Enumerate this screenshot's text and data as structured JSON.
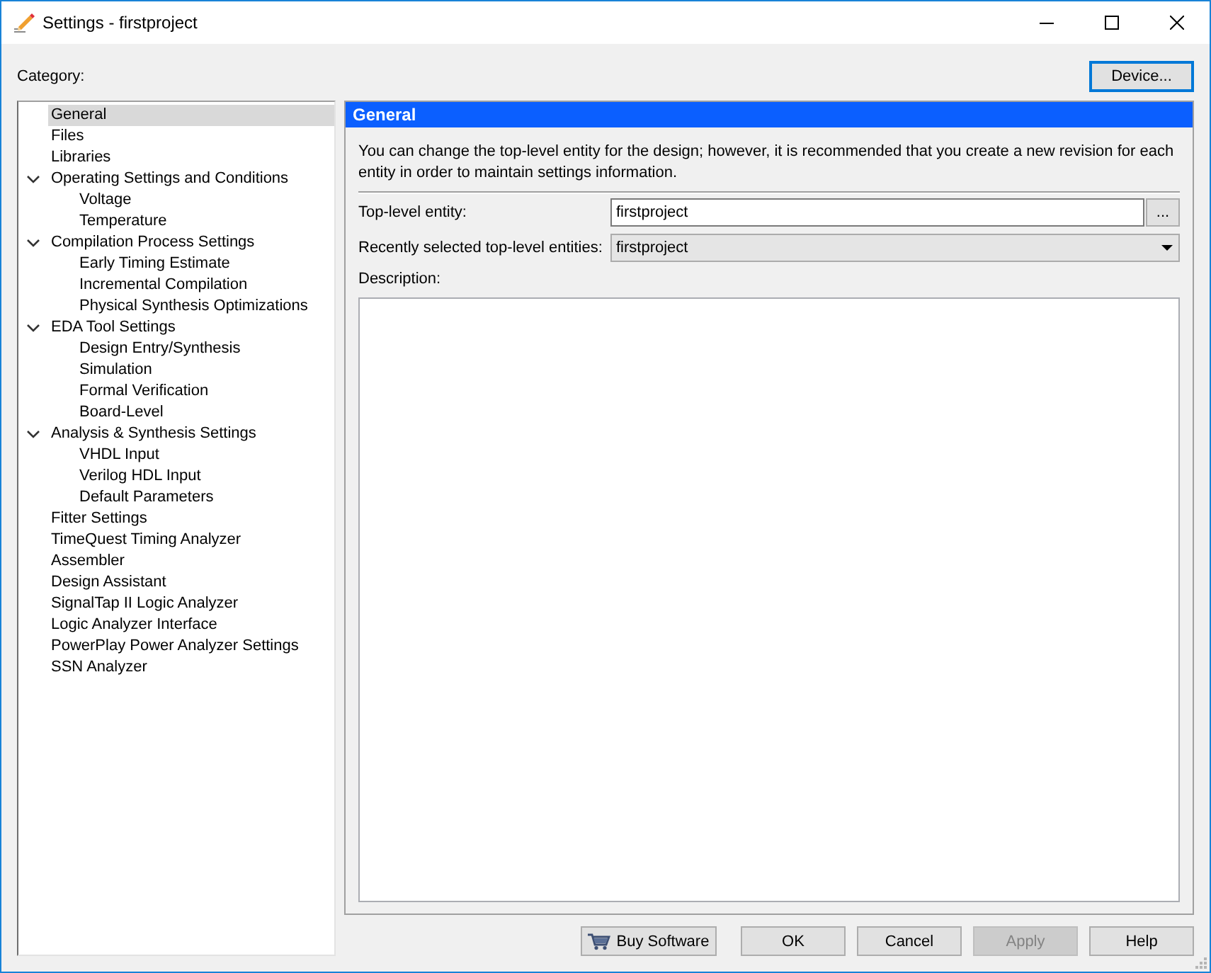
{
  "window": {
    "title": "Settings - firstproject"
  },
  "category": {
    "label": "Category:"
  },
  "device_button": {
    "label": "Device...",
    "focused": true
  },
  "tree": {
    "items": [
      {
        "label": "General",
        "selected": true
      },
      {
        "label": "Files",
        "selected": false
      },
      {
        "label": "Libraries",
        "selected": false
      },
      {
        "label": "Operating Settings and Conditions",
        "selected": false,
        "expanded": true,
        "children": [
          {
            "label": "Voltage",
            "selected": false
          },
          {
            "label": "Temperature",
            "selected": false
          }
        ]
      },
      {
        "label": "Compilation Process Settings",
        "selected": false,
        "expanded": true,
        "children": [
          {
            "label": "Early Timing Estimate",
            "selected": false
          },
          {
            "label": "Incremental Compilation",
            "selected": false
          },
          {
            "label": "Physical Synthesis Optimizations",
            "selected": false
          }
        ]
      },
      {
        "label": "EDA Tool Settings",
        "selected": false,
        "expanded": true,
        "children": [
          {
            "label": "Design Entry/Synthesis",
            "selected": false
          },
          {
            "label": "Simulation",
            "selected": false
          },
          {
            "label": "Formal Verification",
            "selected": false
          },
          {
            "label": "Board-Level",
            "selected": false
          }
        ]
      },
      {
        "label": "Analysis & Synthesis Settings",
        "selected": false,
        "expanded": true,
        "children": [
          {
            "label": "VHDL Input",
            "selected": false
          },
          {
            "label": "Verilog HDL Input",
            "selected": false
          },
          {
            "label": "Default Parameters",
            "selected": false
          }
        ]
      },
      {
        "label": "Fitter Settings",
        "selected": false
      },
      {
        "label": "TimeQuest Timing Analyzer",
        "selected": false
      },
      {
        "label": "Assembler",
        "selected": false
      },
      {
        "label": "Design Assistant",
        "selected": false
      },
      {
        "label": "SignalTap II Logic Analyzer",
        "selected": false
      },
      {
        "label": "Logic Analyzer Interface",
        "selected": false
      },
      {
        "label": "PowerPlay Power Analyzer Settings",
        "selected": false
      },
      {
        "label": "SSN Analyzer",
        "selected": false
      }
    ]
  },
  "panel": {
    "title": "General",
    "intro": "You can change the top-level entity for the design; however, it is recommended that you create a new revision for each entity in order to maintain settings information.",
    "fields": [
      {
        "kind": "text",
        "label": "Top-level entity:",
        "value": "firstproject",
        "browse_label": "..."
      },
      {
        "kind": "dropdown",
        "label": "Recently selected top-level entities:",
        "value": "firstproject"
      }
    ],
    "description": {
      "label": "Description:"
    }
  },
  "buttons": [
    {
      "kind": "purchase",
      "label": "Buy Software",
      "disabled": false
    },
    {
      "kind": "plain",
      "label": "OK",
      "disabled": false
    },
    {
      "kind": "plain",
      "label": "Cancel",
      "disabled": false
    },
    {
      "kind": "plain",
      "label": "Apply",
      "disabled": true
    },
    {
      "kind": "plain",
      "label": "Help",
      "disabled": false
    }
  ]
}
